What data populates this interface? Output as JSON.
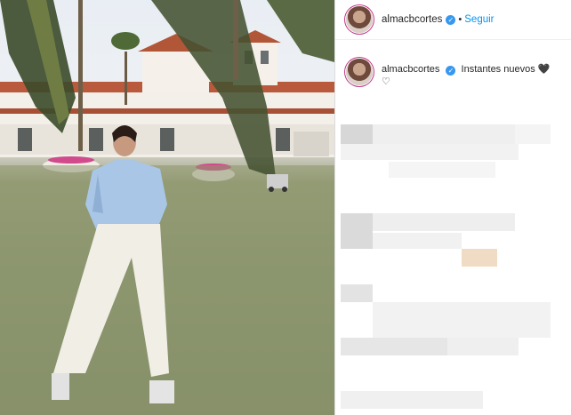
{
  "header": {
    "username": "almacbcortes",
    "verified_mark": "✓",
    "separator": "•",
    "follow_label": "Seguir"
  },
  "caption": {
    "username": "almacbcortes",
    "verified_mark": "✓",
    "text": "Instantes nuevos",
    "emoji_1": "🖤",
    "emoji_2": "♡"
  },
  "icons": {
    "verified": "verified-badge-icon"
  },
  "colors": {
    "follow": "#0095f6",
    "verified": "#3897f0",
    "story_ring": "#c13584"
  }
}
